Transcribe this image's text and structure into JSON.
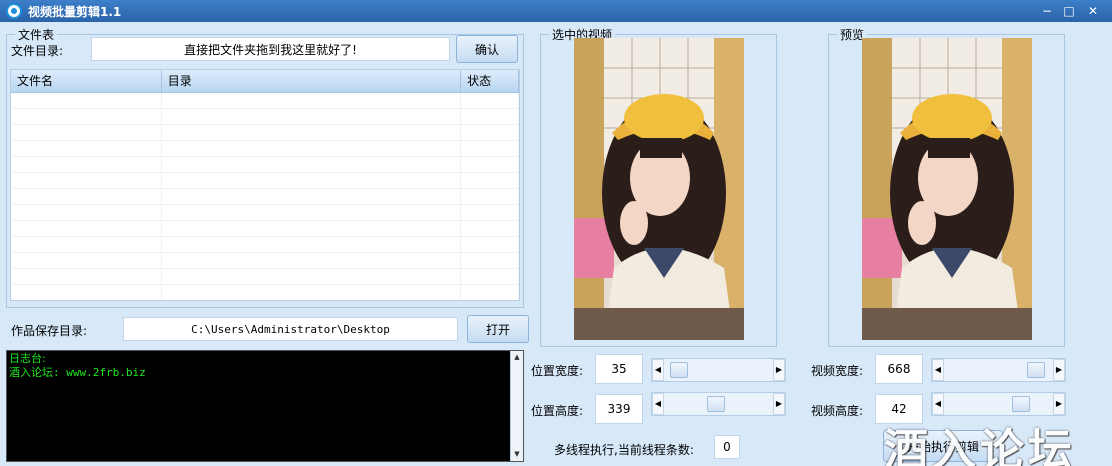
{
  "window": {
    "title": "视频批量剪辑1.1",
    "minimize": "−",
    "maximize": "□",
    "close": "✕",
    "icon": "app-logo-icon"
  },
  "file_table": {
    "legend": "文件表",
    "dir_label": "文件目录:",
    "dir_value": "直接把文件夹拖到我这里就好了!",
    "confirm_label": "确认",
    "columns": [
      "文件名",
      "目录",
      "状态"
    ],
    "rows": []
  },
  "save": {
    "label": "作品保存目录:",
    "path": "C:\\Users\\Administrator\\Desktop",
    "open_label": "打开"
  },
  "log": {
    "lines": [
      "日志台:",
      "酒入论坛: www.2frb.biz"
    ]
  },
  "selected_video": {
    "legend": "选中的视频"
  },
  "preview": {
    "legend": "预览"
  },
  "position": {
    "width_label": "位置宽度:",
    "width_value": "35",
    "height_label": "位置高度:",
    "height_value": "339"
  },
  "video": {
    "width_label": "视频宽度:",
    "width_value": "668",
    "height_label": "视频高度:",
    "height_value": "42"
  },
  "threads": {
    "label": "多线程执行,当前线程条数:",
    "value": "0"
  },
  "start_label": "开始执行剪辑",
  "watermark": "酒入论坛",
  "colors": {
    "titlebar": "#2f6db5",
    "background": "#d7e8f9",
    "console_text": "#1ee81e"
  }
}
